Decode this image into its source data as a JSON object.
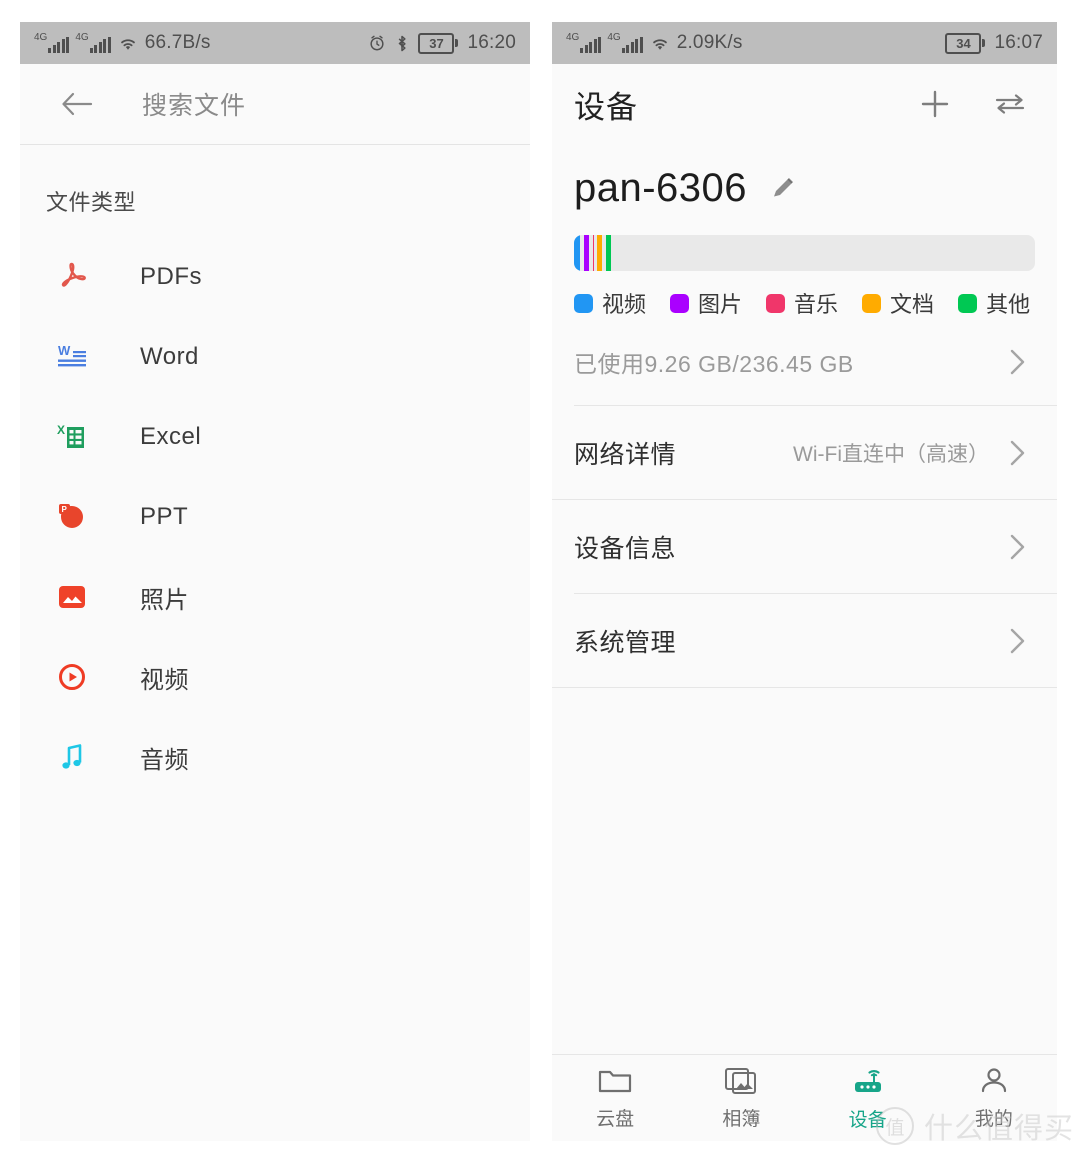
{
  "left_screen": {
    "status_bar": {
      "network_label_1": "4G",
      "network_label_2": "4G",
      "speed": "66.7B/s",
      "battery": "37",
      "time": "16:20",
      "icons": [
        "signal-icon",
        "signal-icon",
        "wifi-icon",
        "alarm-icon",
        "bluetooth-icon",
        "battery-icon"
      ]
    },
    "header": {
      "back_icon": "back-arrow-icon",
      "title": "搜索文件"
    },
    "section_title": "文件类型",
    "file_types": [
      {
        "label": "PDFs",
        "icon": "pdf-icon",
        "color": "#e2574c"
      },
      {
        "label": "Word",
        "icon": "word-icon",
        "color": "#4a7ee0"
      },
      {
        "label": "Excel",
        "icon": "excel-icon",
        "color": "#1f9e5e"
      },
      {
        "label": "PPT",
        "icon": "ppt-icon",
        "color": "#e8452c"
      },
      {
        "label": "照片",
        "icon": "photo-icon",
        "color": "#ef4229"
      },
      {
        "label": "视频",
        "icon": "video-icon",
        "color": "#ef3b24"
      },
      {
        "label": "音频",
        "icon": "audio-icon",
        "color": "#1ec7e6"
      }
    ]
  },
  "right_screen": {
    "status_bar": {
      "network_label_1": "4G",
      "network_label_2": "4G",
      "speed": "2.09K/s",
      "battery": "34",
      "time": "16:07",
      "icons": [
        "signal-icon",
        "signal-icon",
        "wifi-icon",
        "battery-icon"
      ]
    },
    "header": {
      "title": "设备",
      "add_icon": "plus-icon",
      "transfer_icon": "transfer-arrows-icon"
    },
    "device": {
      "name": "pan-6306",
      "edit_icon": "pencil-icon"
    },
    "storage": {
      "usage_text": "已使用9.26 GB/236.45 GB",
      "used_gb": 9.26,
      "total_gb": 236.45,
      "segments": [
        {
          "label": "视频",
          "color": "#2196f3",
          "percent": 1.35
        },
        {
          "label": "图片",
          "color": "#aa00ff",
          "percent": 1.0
        },
        {
          "label": "音乐",
          "color": "#f0366a",
          "percent": 0.1
        },
        {
          "label": "文档",
          "color": "#ffab00",
          "percent": 1.0
        },
        {
          "label": "其他",
          "color": "#00c853",
          "percent": 1.0
        }
      ]
    },
    "rows": [
      {
        "label": "网络详情",
        "value": "Wi-Fi直连中（高速）",
        "chevron": "chevron-right-icon"
      },
      {
        "label": "设备信息",
        "value": "",
        "chevron": "chevron-right-icon"
      },
      {
        "label": "系统管理",
        "value": "",
        "chevron": "chevron-right-icon"
      }
    ],
    "bottom_nav": [
      {
        "label": "云盘",
        "icon": "folder-icon",
        "active": false
      },
      {
        "label": "相簿",
        "icon": "photos-icon",
        "active": false
      },
      {
        "label": "设备",
        "icon": "router-icon",
        "active": true
      },
      {
        "label": "我的",
        "icon": "person-icon",
        "active": false
      }
    ],
    "accent_color": "#17a589"
  },
  "watermark": {
    "mark": "值",
    "text": "什么值得买"
  }
}
